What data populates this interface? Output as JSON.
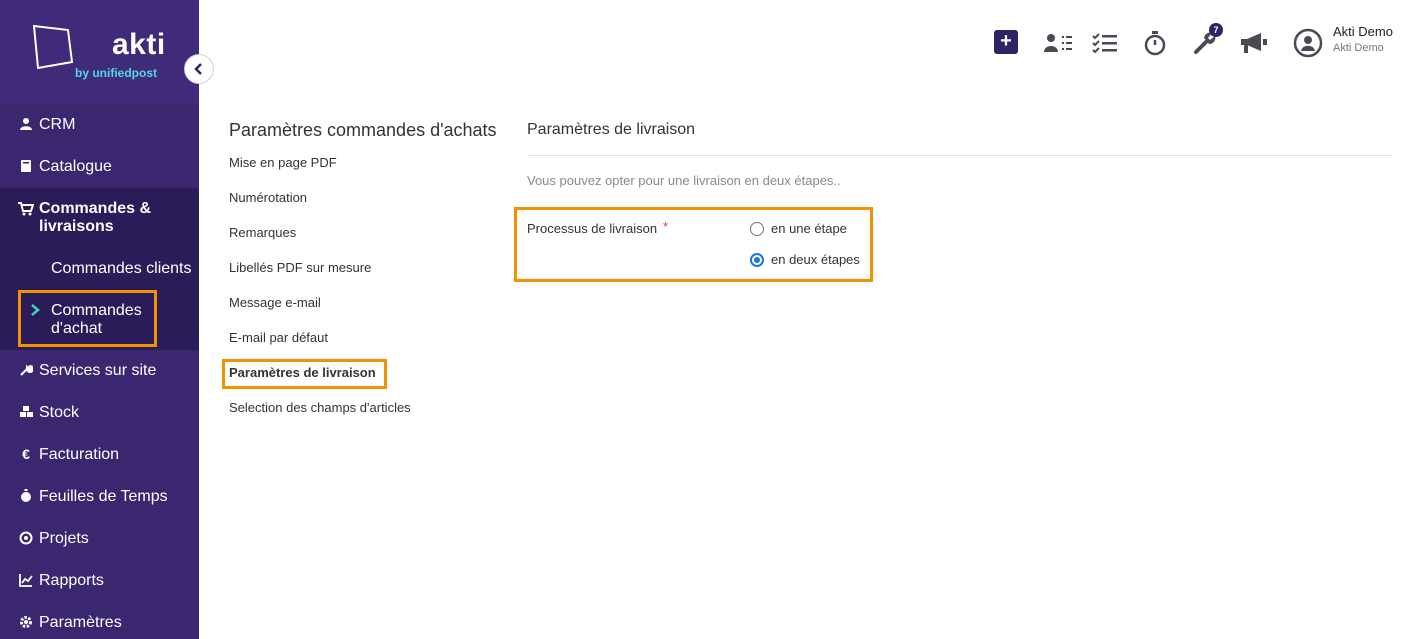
{
  "brand": {
    "name": "akti",
    "tagline": "by unifiedpost"
  },
  "sidebar": {
    "items": [
      {
        "label": "CRM",
        "icon": "user-icon"
      },
      {
        "label": "Catalogue",
        "icon": "book-icon"
      },
      {
        "label": "Commandes & livraisons",
        "label_line1": "Commandes &",
        "label_line2": "livraisons",
        "icon": "cart-icon"
      },
      {
        "label": "Services sur site",
        "icon": "wrench-icon"
      },
      {
        "label": "Stock",
        "icon": "cubes-icon"
      },
      {
        "label": "Facturation",
        "icon": "euro-icon"
      },
      {
        "label": "Feuilles de Temps",
        "icon": "stopwatch-icon"
      },
      {
        "label": "Projets",
        "icon": "target-icon"
      },
      {
        "label": "Rapports",
        "icon": "chart-icon"
      },
      {
        "label": "Paramètres",
        "icon": "gear-icon"
      }
    ],
    "subitems": [
      {
        "label": "Commandes clients"
      },
      {
        "label": "Commandes d'achat",
        "label_line1": "Commandes",
        "label_line2": "d'achat",
        "active": true
      }
    ]
  },
  "topbar": {
    "notification_count": "7",
    "user_name": "Akti Demo",
    "user_company": "Akti Demo"
  },
  "settings": {
    "title": "Paramètres commandes d'achats",
    "links": [
      "Mise en page PDF",
      "Numérotation",
      "Remarques",
      "Libellés PDF sur mesure",
      "Message e-mail",
      "E-mail par défaut",
      "Paramètres de livraison",
      "Selection des champs d'articles"
    ]
  },
  "panel": {
    "title": "Paramètres de livraison",
    "description": "Vous pouvez opter pour une livraison en deux étapes..",
    "field_label": "Processus de livraison",
    "required_mark": "*",
    "options": [
      {
        "label": "en une étape",
        "checked": false
      },
      {
        "label": "en deux étapes",
        "checked": true
      }
    ]
  },
  "colors": {
    "sidebar": "#3a2770",
    "highlight": "#f39200",
    "accent": "#2d2466",
    "radio": "#1a73e8"
  }
}
